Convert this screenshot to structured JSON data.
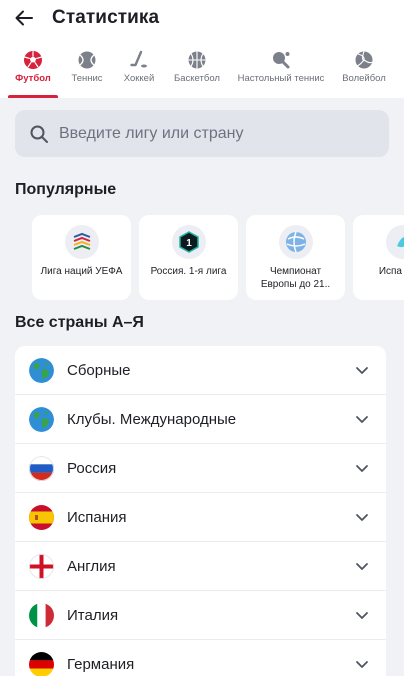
{
  "header": {
    "title": "Статистика",
    "back_icon": "arrow-left-icon"
  },
  "tabs": [
    {
      "label": "Футбол",
      "icon": "soccer-ball-icon",
      "active": true
    },
    {
      "label": "Теннис",
      "icon": "tennis-ball-icon",
      "active": false
    },
    {
      "label": "Хоккей",
      "icon": "hockey-stick-icon",
      "active": false
    },
    {
      "label": "Баскетбол",
      "icon": "basketball-icon",
      "active": false
    },
    {
      "label": "Настольный теннис",
      "icon": "ping-pong-icon",
      "active": false
    },
    {
      "label": "Волейбол",
      "icon": "volleyball-icon",
      "active": false
    }
  ],
  "search": {
    "placeholder": "Введите лигу или страну",
    "value": ""
  },
  "popular": {
    "title": "Популярные",
    "cards": [
      {
        "name": "Лига наций УЕФА"
      },
      {
        "name": "Россия. 1-я лига"
      },
      {
        "name": "Чемпионат Европы до 21.."
      },
      {
        "name": "Испа Сегу"
      }
    ]
  },
  "countries": {
    "title": "Все страны А–Я",
    "items": [
      {
        "label": "Сборные",
        "flag": "globe-icon"
      },
      {
        "label": "Клубы. Международные",
        "flag": "globe-icon"
      },
      {
        "label": "Россия",
        "flag": "russia-flag-icon"
      },
      {
        "label": "Испания",
        "flag": "spain-flag-icon"
      },
      {
        "label": "Англия",
        "flag": "england-flag-icon"
      },
      {
        "label": "Италия",
        "flag": "italy-flag-icon"
      },
      {
        "label": "Германия",
        "flag": "germany-flag-icon"
      }
    ]
  },
  "colors": {
    "accent": "#d6223c",
    "background": "#f1f2f6",
    "search_bg": "#e2e4eb"
  }
}
